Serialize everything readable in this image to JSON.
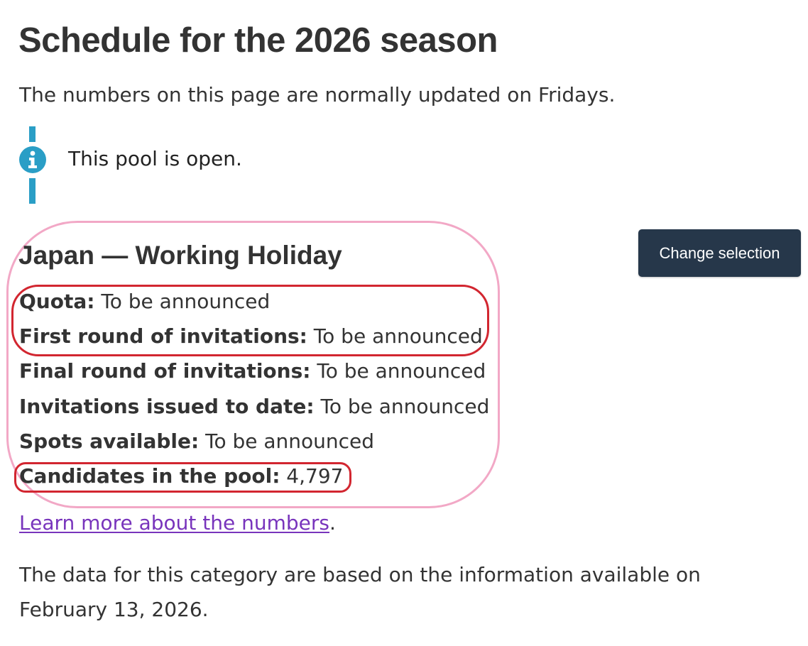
{
  "page": {
    "title": "Schedule for the 2026 season",
    "intro": "The numbers on this page are normally updated on Fridays."
  },
  "alert": {
    "icon": "info-icon",
    "text": "This pool is open.",
    "color": "#2a9ec6"
  },
  "category": {
    "heading": "Japan — Working Holiday",
    "change_button_label": "Change selection",
    "button_color": "#26374a"
  },
  "stats": {
    "quota": {
      "label": "Quota:",
      "value": "To be announced"
    },
    "first_round": {
      "label": "First round of invitations:",
      "value": "To be announced"
    },
    "final_round": {
      "label": "Final round of invitations:",
      "value": "To be announced"
    },
    "issued": {
      "label": "Invitations issued to date:",
      "value": "To be announced"
    },
    "spots": {
      "label": "Spots available:",
      "value": "To be announced"
    },
    "candidates": {
      "label": "Candidates in the pool:",
      "value": "4,797"
    }
  },
  "learn_more": {
    "link_text": "Learn more about the numbers",
    "trailing": ".",
    "link_color": "#7834bc"
  },
  "data_note": "The data for this category are based on the information available on February 13, 2026.",
  "annotations": {
    "pink_outline_color": "#f2a8c6",
    "red_outline_color": "#d22630"
  }
}
